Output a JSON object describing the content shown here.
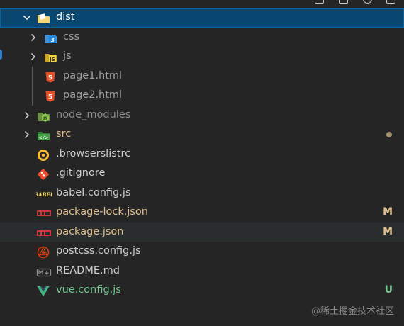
{
  "explorer": {
    "colors": {
      "background": "#252526",
      "selected_row": "#094771",
      "hover_row": "#2a2d2e",
      "default_text": "#cccccc",
      "modified_text": "#e2c08d",
      "untracked_text": "#73c991",
      "ignored_text": "#8c8c8c"
    },
    "items": [
      {
        "label": "dist",
        "kind": "folder",
        "expanded": true,
        "selected": true,
        "icon": "folder-dist-icon"
      },
      {
        "label": "css",
        "kind": "folder",
        "expanded": false,
        "icon": "css-folder-icon"
      },
      {
        "label": "js",
        "kind": "folder",
        "expanded": false,
        "icon": "js-folder-icon"
      },
      {
        "label": "page1.html",
        "kind": "file",
        "icon": "html-file-icon"
      },
      {
        "label": "page2.html",
        "kind": "file",
        "icon": "html-file-icon"
      },
      {
        "label": "node_modules",
        "kind": "folder",
        "expanded": false,
        "icon": "node-folder-icon"
      },
      {
        "label": "src",
        "kind": "folder",
        "expanded": false,
        "icon": "src-folder-icon"
      },
      {
        "label": ".browserslistrc",
        "kind": "file",
        "icon": "browserslist-icon"
      },
      {
        "label": ".gitignore",
        "kind": "file",
        "icon": "git-icon"
      },
      {
        "label": "babel.config.js",
        "kind": "file",
        "icon": "babel-icon"
      },
      {
        "label": "package-lock.json",
        "kind": "file",
        "git_status": "M",
        "icon": "npm-icon"
      },
      {
        "label": "package.json",
        "kind": "file",
        "git_status": "M",
        "icon": "npm-icon"
      },
      {
        "label": "postcss.config.js",
        "kind": "file",
        "icon": "postcss-icon"
      },
      {
        "label": "README.md",
        "kind": "file",
        "icon": "markdown-icon"
      },
      {
        "label": "vue.config.js",
        "kind": "file",
        "git_status": "U",
        "icon": "vue-icon"
      }
    ]
  },
  "watermark": "@稀土掘金技术社区"
}
